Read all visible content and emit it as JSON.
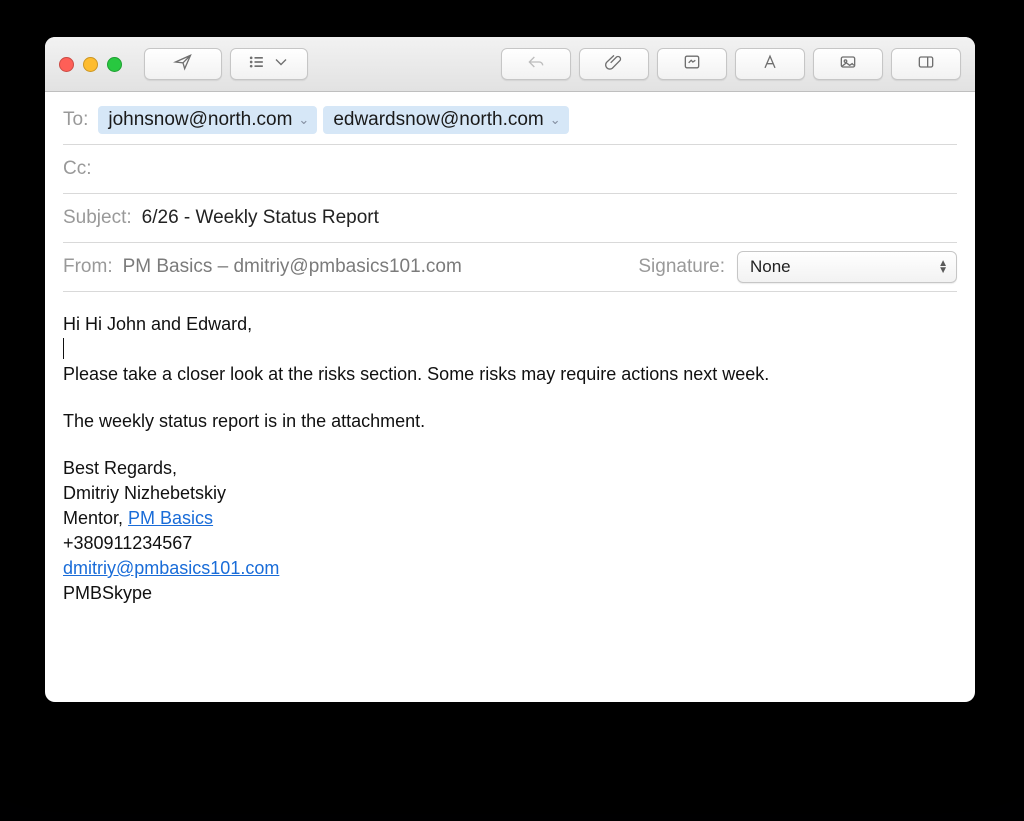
{
  "colors": {
    "close": "#fe5f57",
    "minimize": "#febc2e",
    "zoom": "#28c840",
    "chip_bg": "#d6e7f7",
    "link": "#196cd8"
  },
  "toolbar": {
    "send_icon": "send",
    "list_icon": "list",
    "reply_icon": "reply",
    "attach_icon": "attach",
    "camera_icon": "camera",
    "font_icon": "font",
    "media_icon": "media",
    "sidebar_icon": "sidebar"
  },
  "fields": {
    "to_label": "To:",
    "to": [
      "johnsnow@north.com",
      "edwardsnow@north.com"
    ],
    "cc_label": "Cc:",
    "cc": "",
    "subject_label": "Subject:",
    "subject": "6/26 - Weekly Status Report",
    "from_label": "From:",
    "from": "PM Basics – dmitriy@pmbasics101.com",
    "signature_label": "Signature:",
    "signature_value": "None"
  },
  "body": {
    "greeting": "Hi Hi John and Edward,",
    "p1": "Please take a closer look at the risks section. Some risks may require actions next week.",
    "p2": "The weekly status report is in the attachment.",
    "closing": "Best Regards,",
    "name": "Dmitriy Nizhebetskiy",
    "role_prefix": "Mentor, ",
    "role_link": "PM Basics",
    "phone": "+380911234567",
    "email": "dmitriy@pmbasics101.com",
    "skype": "PMBSkype"
  }
}
